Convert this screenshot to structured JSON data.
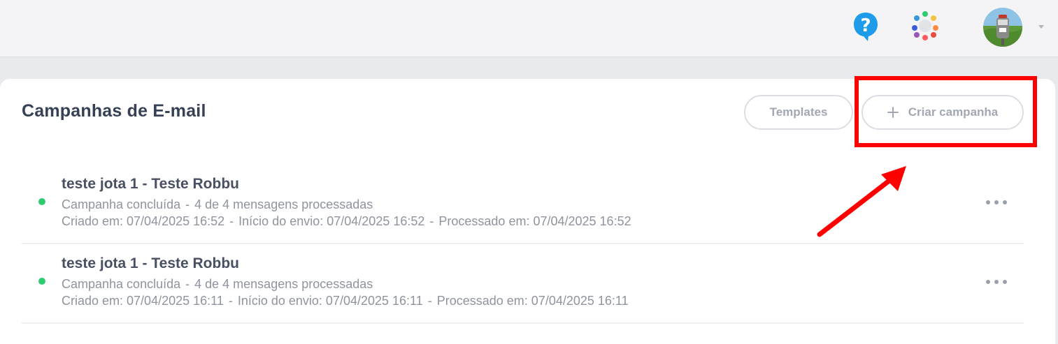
{
  "header": {
    "help_icon": "question-bubble-icon",
    "apps_icon": "apps-dots-icon",
    "avatar_icon": "user-avatar",
    "caret_icon": "caret-down-icon"
  },
  "page": {
    "title": "Campanhas de E-mail",
    "templates_label": "Templates",
    "create_label": "Criar campanha"
  },
  "campaigns": [
    {
      "title": "teste jota 1 - Teste Robbu",
      "status": "Campanha concluída",
      "progress": "4 de 4 mensagens processadas",
      "created": "Criado em: 07/04/2025 16:52",
      "started": "Início do envio: 07/04/2025 16:52",
      "processed": "Processado em: 07/04/2025 16:52",
      "status_color": "#2ecc71"
    },
    {
      "title": "teste jota 1 - Teste Robbu",
      "status": "Campanha concluída",
      "progress": "4 de 4 mensagens processadas",
      "created": "Criado em: 07/04/2025 16:11",
      "started": "Início do envio: 07/04/2025 16:11",
      "processed": "Processado em: 07/04/2025 16:11",
      "status_color": "#2ecc71"
    }
  ],
  "separator": "-",
  "annotation": {
    "color": "#ff0000"
  }
}
